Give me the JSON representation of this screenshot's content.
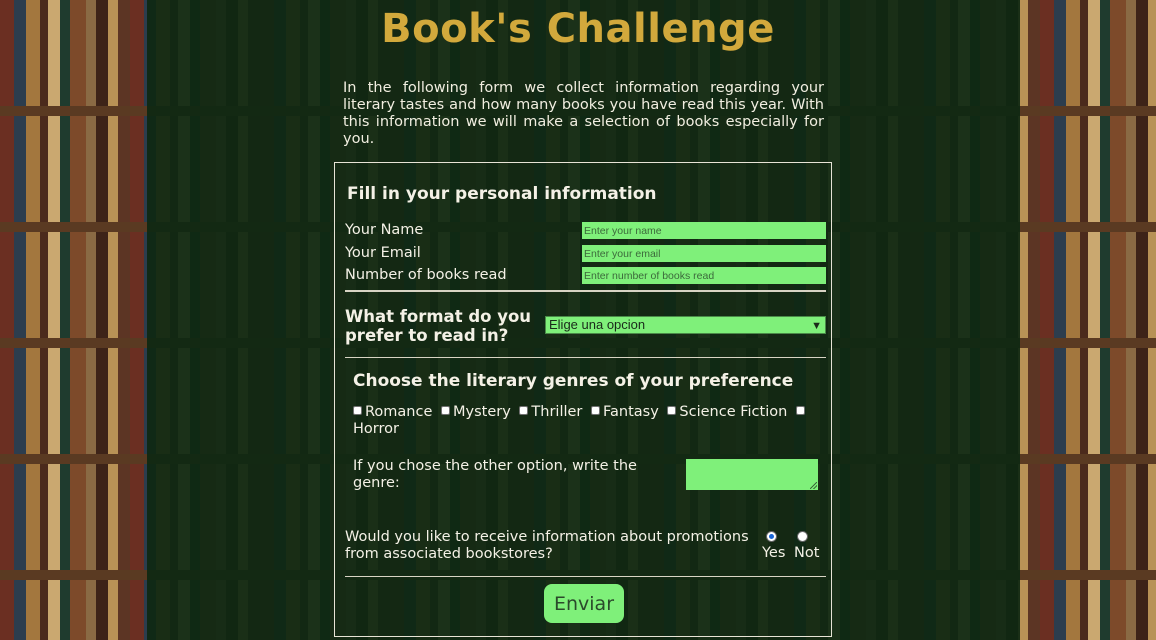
{
  "header": {
    "title": "Book's Challenge",
    "intro": "In the following form we collect information regarding your literary tastes and how many books you have read this year. With this information we will make a selection of books especially for you."
  },
  "personal": {
    "section_title": "Fill in your personal information",
    "name_label": "Your Name",
    "name_placeholder": "Enter your name",
    "email_label": "Your Email",
    "email_placeholder": "Enter your email",
    "books_label": "Number of books read",
    "books_placeholder": "Enter number of books read"
  },
  "format": {
    "label": "What format do you prefer to read in?",
    "selected": "Elige una opcion"
  },
  "genres": {
    "section_title": "Choose the literary genres of your preference",
    "options": [
      "Romance",
      "Mystery",
      "Thriller",
      "Fantasy",
      "Science Fiction",
      "Horror"
    ],
    "other_label": "If you chose the other option, write the genre:"
  },
  "promotions": {
    "question": "Would you like to receive information about promotions from associated bookstores?",
    "yes_label": "Yes",
    "no_label": "Not",
    "selected": "Yes"
  },
  "submit": {
    "label": "Enviar"
  },
  "colors": {
    "title": "#d2a93c",
    "panel": "#0e2812",
    "input": "#7ff07a"
  },
  "icons": {
    "select_arrow": "chevron-down-icon",
    "textarea_resize": "resize-grip-icon"
  }
}
